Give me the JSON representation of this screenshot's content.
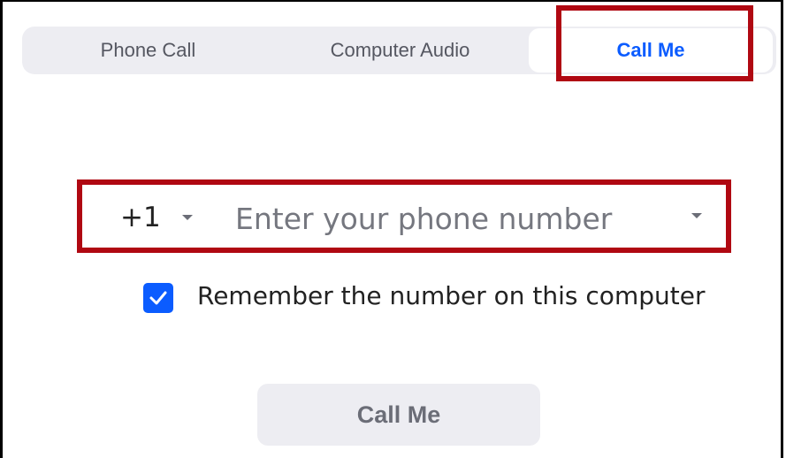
{
  "tabs": [
    {
      "label": "Phone Call",
      "active": false
    },
    {
      "label": "Computer Audio",
      "active": false
    },
    {
      "label": "Call Me",
      "active": true
    }
  ],
  "phone": {
    "country_code": "+1",
    "value": "",
    "placeholder": "Enter your phone number"
  },
  "remember": {
    "label": "Remember the number on this computer",
    "checked": true
  },
  "call_button": {
    "label": "Call Me"
  },
  "colors": {
    "accent": "#0b5cff",
    "highlight": "#b00812",
    "tab_bar": "#ededf2"
  },
  "icons": [
    "chevron-down-icon",
    "checkmark-icon"
  ]
}
